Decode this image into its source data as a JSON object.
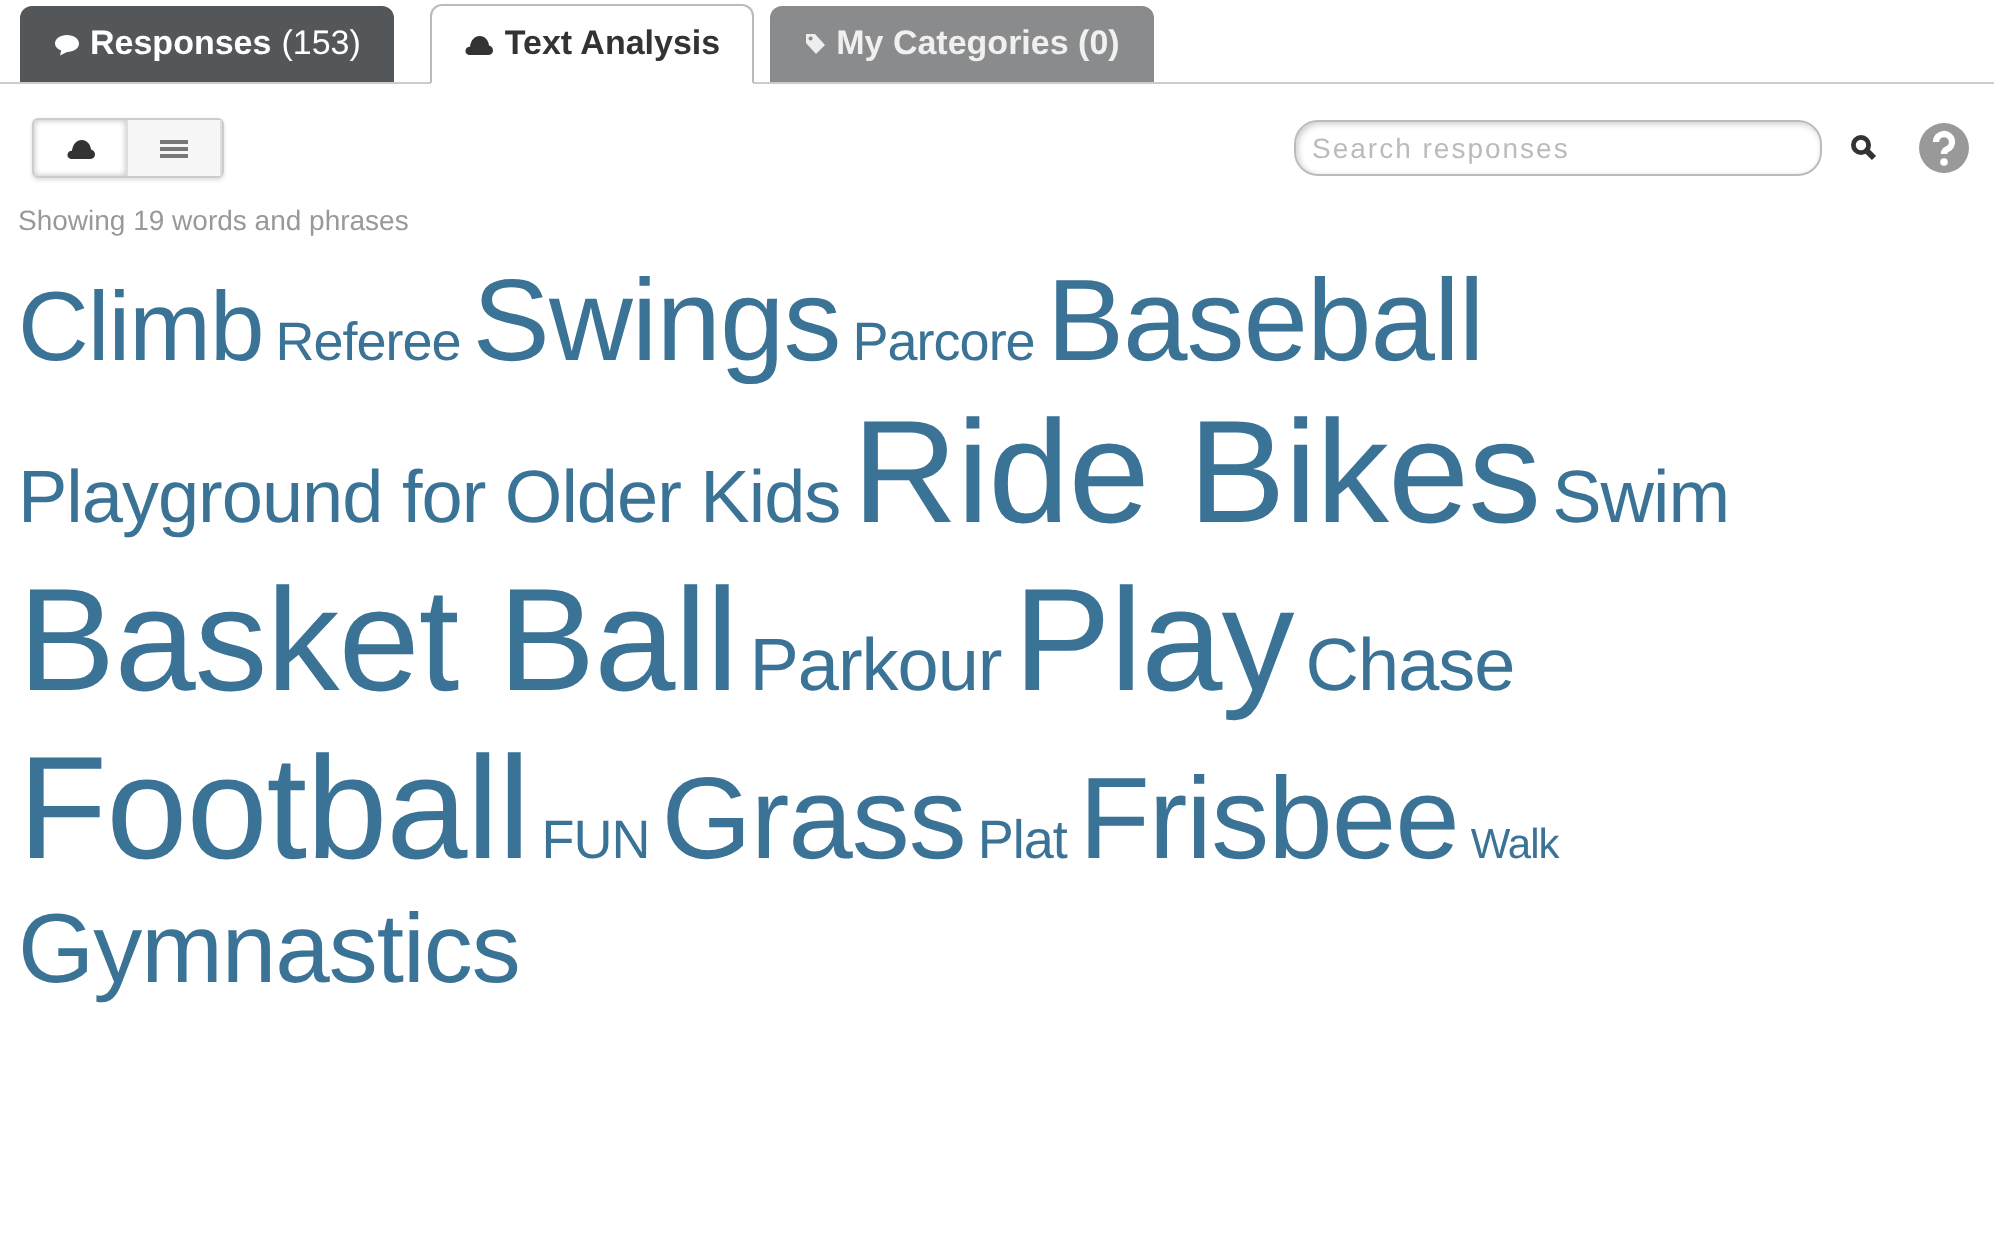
{
  "tabs": [
    {
      "label": "Responses",
      "count": "(153)",
      "kind": "bubble",
      "selected": false,
      "disabled": false
    },
    {
      "label": "Text Analysis",
      "kind": "cloud",
      "selected": true,
      "disabled": false
    },
    {
      "label": "My Categories (0)",
      "kind": "tag",
      "selected": false,
      "disabled": true
    }
  ],
  "view_toggle": [
    {
      "kind": "cloud",
      "selected": true
    },
    {
      "kind": "list",
      "selected": false
    }
  ],
  "search": {
    "placeholder": "Search responses"
  },
  "summary": "Showing 19 words and phrases",
  "words": [
    {
      "text": "Climb",
      "kind": "large"
    },
    {
      "text": "Referee",
      "kind": "small"
    },
    {
      "text": "Swings",
      "kind": "xl"
    },
    {
      "text": "Parcore",
      "kind": "small"
    },
    {
      "text": "Baseball",
      "kind": "xl"
    },
    {
      "text": "Playground for Older Kids",
      "kind": "medium"
    },
    {
      "text": "Ride Bikes",
      "kind": "xxl"
    },
    {
      "text": "Swim",
      "kind": "medium"
    },
    {
      "text": "Basket Ball",
      "kind": "xxl"
    },
    {
      "text": "Parkour",
      "kind": "medium"
    },
    {
      "text": "Play",
      "kind": "xxl"
    },
    {
      "text": "Chase",
      "kind": "medium"
    },
    {
      "text": "Football",
      "kind": "xxl"
    },
    {
      "text": "FUN",
      "kind": "small"
    },
    {
      "text": "Grass",
      "kind": "xl"
    },
    {
      "text": "Plat",
      "kind": "small"
    },
    {
      "text": "Frisbee",
      "kind": "xl"
    },
    {
      "text": "Walk",
      "kind": "tiny"
    },
    {
      "text": "Gymnastics",
      "kind": "large"
    }
  ]
}
